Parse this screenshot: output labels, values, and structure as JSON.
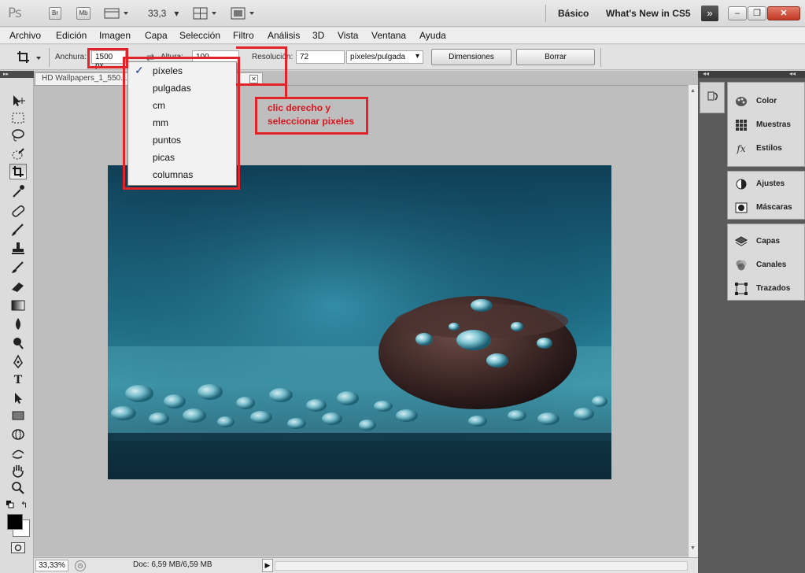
{
  "titlebar": {
    "app_logo": "Ps",
    "bridge": "Br",
    "mini_bridge": "Mb",
    "zoom_value": "33,3",
    "workspace_basic": "Básico",
    "workspace_whats_new": "What's New in CS5",
    "more_workspaces": "»",
    "minimize": "–",
    "restore": "❐",
    "close": "✕"
  },
  "menu": [
    "Archivo",
    "Edición",
    "Imagen",
    "Capa",
    "Selección",
    "Filtro",
    "Análisis",
    "3D",
    "Vista",
    "Ventana",
    "Ayuda"
  ],
  "options": {
    "width_label": "Anchura:",
    "width_value": "1500 px",
    "height_label": "Altura:",
    "height_value": "100",
    "resolution_label": "Resolución:",
    "resolution_value": "72",
    "resolution_unit": "píxeles/pulgada",
    "dimensions_button": "Dimensiones",
    "clear_button": "Borrar"
  },
  "unit_menu": {
    "selected": "píxeles",
    "items": [
      "píxeles",
      "pulgadas",
      "cm",
      "mm",
      "puntos",
      "picas",
      "columnas"
    ]
  },
  "document": {
    "tab_title": "HD Wallpapers_1_550...",
    "zoom": "33,33%",
    "doc_info": "Doc: 6,59 MB/6,59 MB"
  },
  "annotation": {
    "line1": "clic derecho y",
    "line2": "seleccionar pixeles",
    "color": "#e0242a"
  },
  "panels": {
    "group1": [
      "Color",
      "Muestras",
      "Estilos"
    ],
    "group2": [
      "Ajustes",
      "Máscaras"
    ],
    "group3": [
      "Capas",
      "Canales",
      "Trazados"
    ]
  }
}
